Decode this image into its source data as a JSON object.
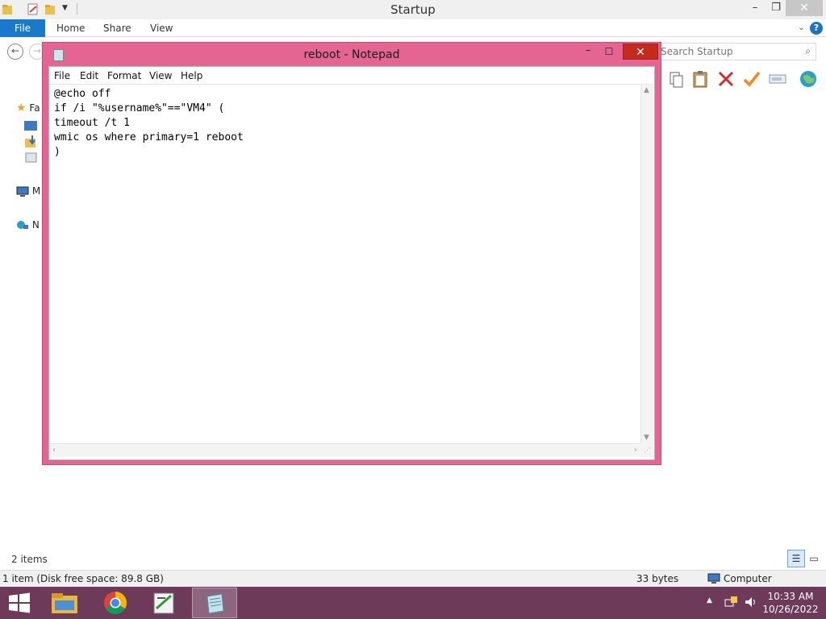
{
  "explorer": {
    "title": "Startup",
    "ribbon_tabs": [
      "File",
      "Home",
      "Share",
      "View"
    ],
    "search_placeholder": "Search Startup",
    "nav_items": {
      "favorites": "Fa",
      "my_computer": "M",
      "network": "N"
    },
    "items_count": "2 items",
    "status": {
      "selection": "1 item (Disk free space: 89.8 GB)",
      "size": "33 bytes",
      "location": "Computer"
    }
  },
  "notepad": {
    "title": "reboot - Notepad",
    "menus": [
      "File",
      "Edit",
      "Format",
      "View",
      "Help"
    ],
    "content": "@echo off\nif /i \"%username%\"==\"VM4\" (\ntimeout /t 1\nwmic os where primary=1 reboot\n)"
  },
  "taskbar": {
    "apps": [
      "file-explorer",
      "chrome",
      "script-editor",
      "notepad"
    ],
    "time": "10:33 AM",
    "date": "10/26/2022"
  },
  "colors": {
    "notepad_frame": "#e46591",
    "taskbar": "#6e3a5a",
    "file_tab": "#1979ca",
    "close_button": "#c42b1c"
  }
}
